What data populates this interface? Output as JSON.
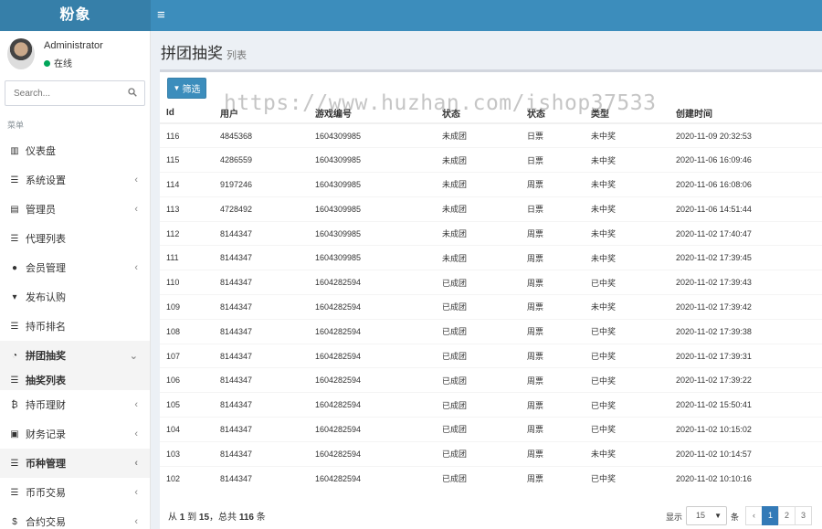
{
  "app": {
    "logo": "粉象",
    "menu_toggle": "≡"
  },
  "user": {
    "name": "Administrator",
    "status": "在线"
  },
  "search": {
    "placeholder": "Search..."
  },
  "menu_header": "菜单",
  "menu": [
    {
      "label": "仪表盘",
      "icon": "chart-icon",
      "chevron": false
    },
    {
      "label": "系统设置",
      "icon": "sliders-icon",
      "chevron": true
    },
    {
      "label": "管理员",
      "icon": "id-card-icon",
      "chevron": true
    },
    {
      "label": "代理列表",
      "icon": "list-icon",
      "chevron": false
    },
    {
      "label": "会员管理",
      "icon": "users-icon",
      "chevron": true
    },
    {
      "label": "发布认购",
      "icon": "cart-icon",
      "chevron": false
    },
    {
      "label": "持币排名",
      "icon": "list-icon",
      "chevron": false
    },
    {
      "label": "拼团抽奖",
      "icon": "dashboard-icon",
      "chevron": true,
      "expanded": true
    },
    {
      "label": "抽奖列表",
      "icon": "list-icon",
      "chevron": false,
      "sub": true
    },
    {
      "label": "持币理财",
      "icon": "bitcoin-icon",
      "chevron": true
    },
    {
      "label": "财务记录",
      "icon": "money-icon",
      "chevron": true
    },
    {
      "label": "币种管理",
      "icon": "list-icon",
      "chevron": true,
      "active": true
    },
    {
      "label": "币币交易",
      "icon": "list-icon",
      "chevron": true
    },
    {
      "label": "合约交易",
      "icon": "dollar-icon",
      "chevron": true
    }
  ],
  "page": {
    "title": "拼团抽奖",
    "subtitle": "列表"
  },
  "filter_button": "筛选",
  "table": {
    "headers": [
      "Id",
      "用户",
      "游戏编号",
      "状态",
      "状态",
      "类型",
      "创建时间"
    ],
    "rows": [
      [
        "116",
        "4845368",
        "1604309985",
        "未成团",
        "日票",
        "未中奖",
        "2020-11-09 20:32:53"
      ],
      [
        "115",
        "4286559",
        "1604309985",
        "未成团",
        "日票",
        "未中奖",
        "2020-11-06 16:09:46"
      ],
      [
        "114",
        "9197246",
        "1604309985",
        "未成团",
        "周票",
        "未中奖",
        "2020-11-06 16:08:06"
      ],
      [
        "113",
        "4728492",
        "1604309985",
        "未成团",
        "日票",
        "未中奖",
        "2020-11-06 14:51:44"
      ],
      [
        "112",
        "8144347",
        "1604309985",
        "未成团",
        "周票",
        "未中奖",
        "2020-11-02 17:40:47"
      ],
      [
        "111",
        "8144347",
        "1604309985",
        "未成团",
        "周票",
        "未中奖",
        "2020-11-02 17:39:45"
      ],
      [
        "110",
        "8144347",
        "1604282594",
        "已成团",
        "周票",
        "已中奖",
        "2020-11-02 17:39:43"
      ],
      [
        "109",
        "8144347",
        "1604282594",
        "已成团",
        "周票",
        "未中奖",
        "2020-11-02 17:39:42"
      ],
      [
        "108",
        "8144347",
        "1604282594",
        "已成团",
        "周票",
        "已中奖",
        "2020-11-02 17:39:38"
      ],
      [
        "107",
        "8144347",
        "1604282594",
        "已成团",
        "周票",
        "已中奖",
        "2020-11-02 17:39:31"
      ],
      [
        "106",
        "8144347",
        "1604282594",
        "已成团",
        "周票",
        "已中奖",
        "2020-11-02 17:39:22"
      ],
      [
        "105",
        "8144347",
        "1604282594",
        "已成团",
        "周票",
        "已中奖",
        "2020-11-02 15:50:41"
      ],
      [
        "104",
        "8144347",
        "1604282594",
        "已成团",
        "周票",
        "已中奖",
        "2020-11-02 10:15:02"
      ],
      [
        "103",
        "8144347",
        "1604282594",
        "已成团",
        "周票",
        "未中奖",
        "2020-11-02 10:14:57"
      ],
      [
        "102",
        "8144347",
        "1604282594",
        "已成团",
        "周票",
        "已中奖",
        "2020-11-02 10:10:16"
      ]
    ]
  },
  "footer": {
    "from_label": "从",
    "from": "1",
    "to_label": "到",
    "to": "15",
    "total_label": "，总共",
    "total": "116",
    "unit": "条"
  },
  "pagination": {
    "show_label": "显示",
    "page_size": "15",
    "per_label": "条",
    "pages": [
      "‹",
      "1",
      "2",
      "3"
    ],
    "current": "1"
  },
  "watermark": "https://www.huzhan.com/ishop37533"
}
